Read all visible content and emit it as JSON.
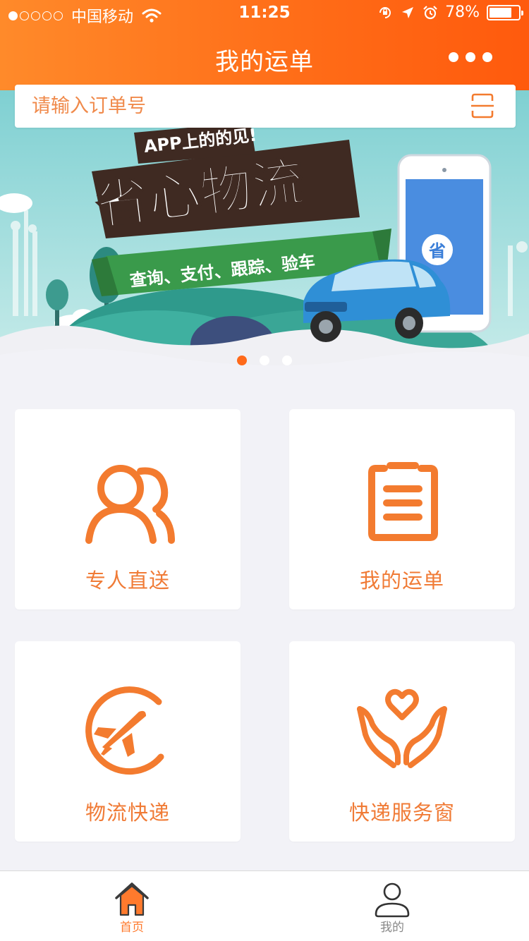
{
  "status_bar": {
    "carrier": "中国移动",
    "time": "11:25",
    "battery": "78%",
    "battery_level": 0.78,
    "signal_dots_filled": 1,
    "signal_dots_total": 5
  },
  "nav": {
    "title": "我的运单",
    "more_icon": "more-dots-icon"
  },
  "search": {
    "placeholder": "请输入订单号",
    "scan_icon": "scan-icon"
  },
  "banner": {
    "tagline": "APP上的的见!",
    "headline": "省心物流",
    "ribbon": "查询、支付、跟踪、验车",
    "phone_badge": "省",
    "slide_count": 3,
    "active_slide": 1
  },
  "menu": [
    {
      "label": "专人直送",
      "icon": "users-icon"
    },
    {
      "label": "我的运单",
      "icon": "clipboard-icon"
    },
    {
      "label": "物流快递",
      "icon": "airplane-icon"
    },
    {
      "label": "快递服务窗",
      "icon": "heart-hands-icon"
    }
  ],
  "tabbar": {
    "tabs": [
      {
        "label": "首页",
        "icon": "home-icon",
        "active": true
      },
      {
        "label": "我的",
        "icon": "user-icon",
        "active": false
      }
    ]
  },
  "colors": {
    "accent": "#ff6b17",
    "icon_orange": "#f37b2f",
    "background": "#f2f2f7"
  }
}
